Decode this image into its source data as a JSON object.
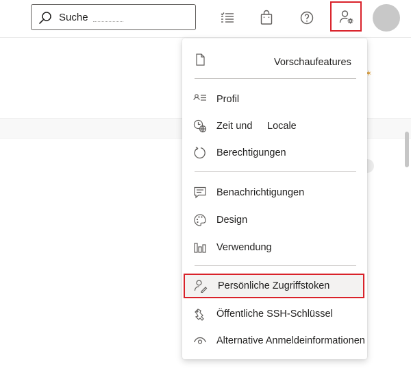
{
  "search": {
    "placeholder": "Suche"
  },
  "topbar": {
    "icons": [
      "task-list-icon",
      "shopping-bag-icon",
      "help-icon",
      "user-settings-icon"
    ]
  },
  "menu": {
    "preview": "Vorschaufeatures",
    "group1": [
      {
        "label": "Profil",
        "icon": "profile-icon"
      },
      {
        "label": "Zeit und",
        "label2": "Locale",
        "icon": "time-locale-icon"
      },
      {
        "label": "Berechtigungen",
        "icon": "permissions-icon"
      }
    ],
    "group2": [
      {
        "label": "Benachrichtigungen",
        "icon": "notifications-icon"
      },
      {
        "label": "Design",
        "icon": "palette-icon"
      },
      {
        "label": "Verwendung",
        "icon": "usage-icon"
      }
    ],
    "group3": [
      {
        "label": "Persönliche Zugriffstoken",
        "icon": "personal-access-token-icon",
        "highlighted": true
      },
      {
        "label": "Öffentliche SSH-Schlüssel",
        "icon": "ssh-key-icon"
      },
      {
        "label": "Alternative Anmeldeinformationen",
        "icon": "alternate-credentials-icon"
      }
    ]
  },
  "colors": {
    "highlight_border": "#d9222a",
    "avatar": "#c8c8c8",
    "text": "#201f1e"
  }
}
